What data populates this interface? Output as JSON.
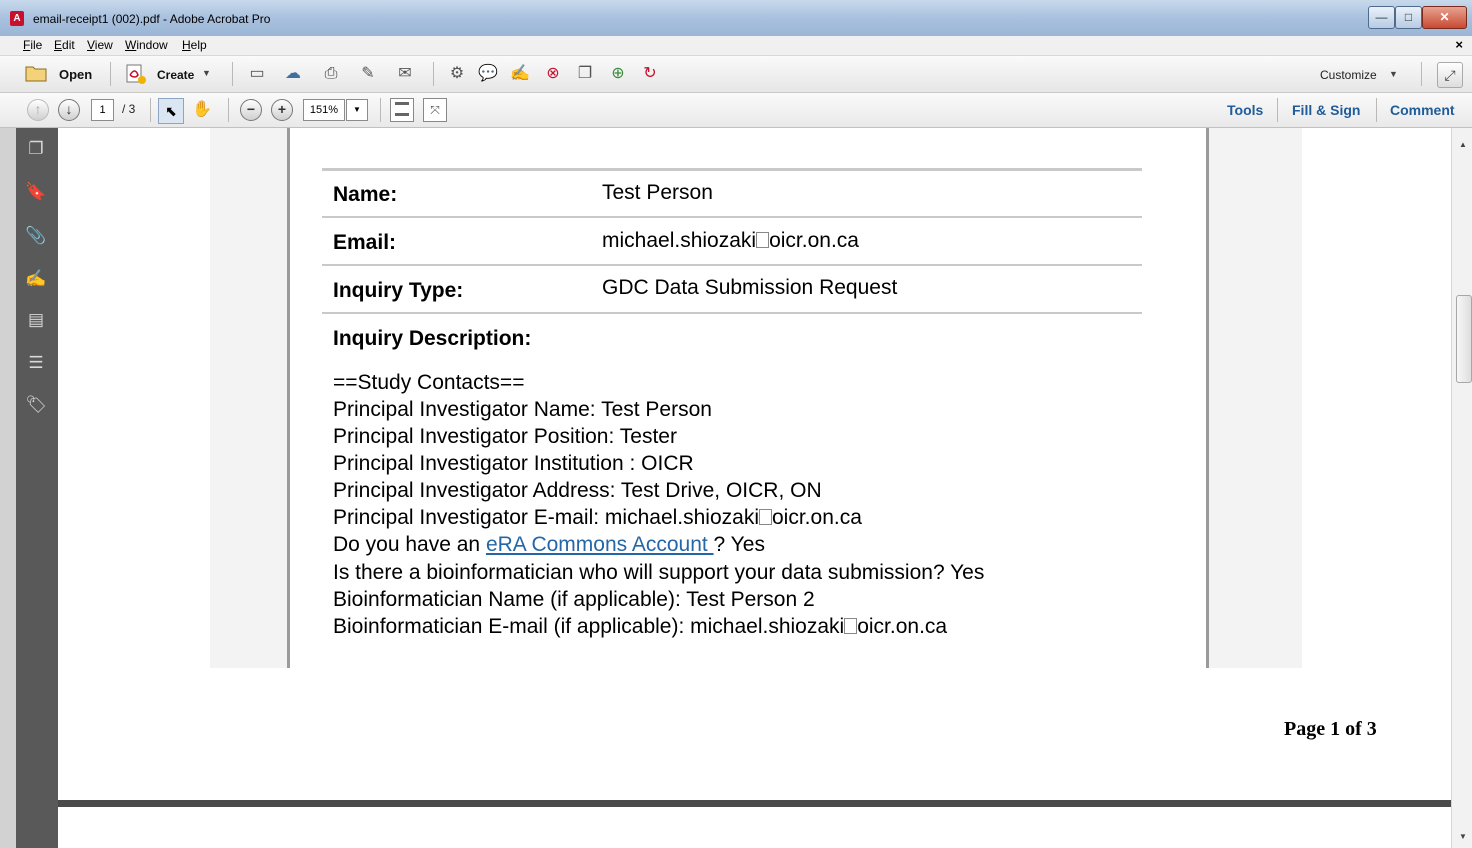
{
  "window": {
    "title": "email-receipt1 (002).pdf - Adobe Acrobat Pro",
    "app_icon": "pdf-icon",
    "controls": {
      "minimize": "—",
      "maximize": "□",
      "close": "✕"
    }
  },
  "menu": {
    "items": [
      "File",
      "Edit",
      "View",
      "Window",
      "Help"
    ],
    "close_doc": "×"
  },
  "toolbar": {
    "open_label": "Open",
    "create_label": "Create",
    "customize_label": "Customize"
  },
  "nav": {
    "page_current": "1",
    "page_total": "/ 3",
    "zoom": "151%",
    "tools": "Tools",
    "fill_sign": "Fill & Sign",
    "comment": "Comment"
  },
  "document": {
    "fields": [
      {
        "label": "Name:",
        "value": "Test Person"
      },
      {
        "label": "Email:",
        "value_pre": "michael.shiozaki",
        "value_post": "oicr.on.ca"
      },
      {
        "label": "Inquiry Type:",
        "value": "GDC Data Submission Request"
      }
    ],
    "description_label": "Inquiry Description:",
    "description": {
      "l1": "==Study Contacts==",
      "l2": "Principal Investigator Name: Test Person",
      "l3": "Principal Investigator Position: Tester",
      "l4": "Principal Investigator Institution : OICR",
      "l5": "Principal Investigator Address: Test Drive, OICR, ON",
      "l6_pre": "Principal Investigator E-mail: michael.shiozaki",
      "l6_post": "oicr.on.ca",
      "l7_pre": "Do you have an ",
      "l7_link": "eRA Commons Account ",
      "l7_post": "? Yes",
      "l8": "Is there a bioinformatician who will support your data submission? Yes",
      "l9": "Bioinformatician Name (if applicable): Test Person 2",
      "l10_pre": "Bioinformatician E-mail (if applicable): michael.shiozaki",
      "l10_post": "oicr.on.ca"
    },
    "footer": "Page 1 of 3"
  },
  "colors": {
    "link": "#2467a8",
    "accent": "#1f5c99"
  }
}
